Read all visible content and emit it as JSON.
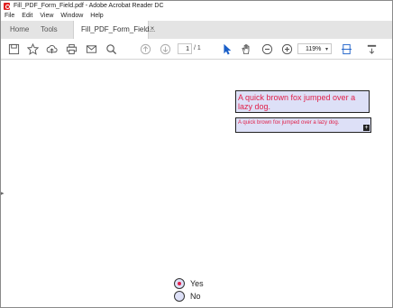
{
  "window": {
    "title": "Fill_PDF_Form_Field.pdf - Adobe Acrobat Reader DC"
  },
  "menu": [
    "File",
    "Edit",
    "View",
    "Window",
    "Help"
  ],
  "tabs": {
    "home": "Home",
    "tools": "Tools",
    "document": "Fill_PDF_Form_Field...",
    "close": "×"
  },
  "toolbar": {
    "page_current": "1",
    "page_total": "/ 1",
    "zoom": "119%",
    "zoom_caret": "▾"
  },
  "form": {
    "text_field_large": "A quick brown fox jumped over a lazy dog.",
    "text_field_small": "A quick brown fox jumped over a lazy dog.",
    "overflow_marker": "+",
    "radio_options": [
      {
        "label": "Yes",
        "selected": true
      },
      {
        "label": "No",
        "selected": false
      }
    ]
  },
  "colors": {
    "field_bg": "#dde0f7",
    "field_text": "#e0204a",
    "acrobat_red": "#e02020"
  }
}
